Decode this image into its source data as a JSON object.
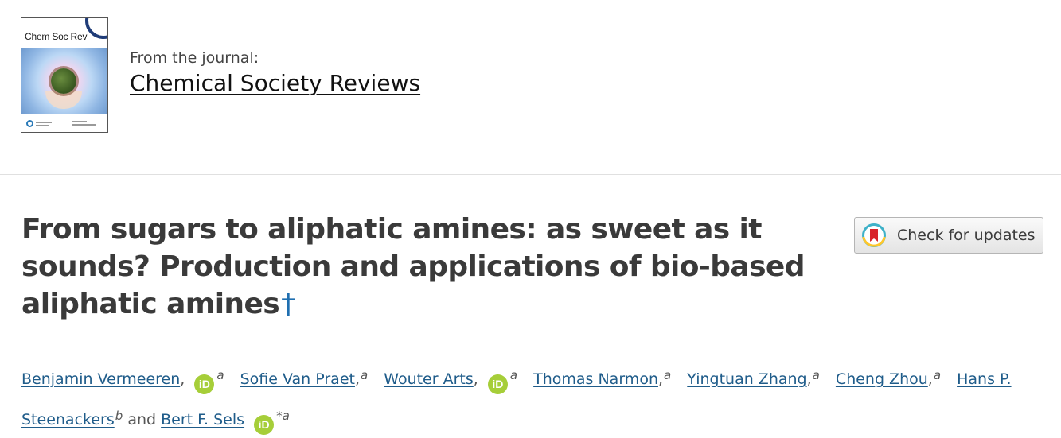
{
  "journal": {
    "cover_title": "Chem Soc Rev",
    "from_label": "From the journal:",
    "name": "Chemical Society Reviews"
  },
  "article": {
    "title": "From sugars to aliphatic amines: as sweet as it sounds? Production and applications of bio-based aliphatic amines",
    "footnote_symbol": "†"
  },
  "updates": {
    "label": "Check for updates",
    "icon": "crossmark-icon"
  },
  "authors": [
    {
      "name": "Benjamin Vermeeren",
      "orcid": true,
      "affiliation": "a"
    },
    {
      "name": "Sofie Van Praet",
      "orcid": false,
      "affiliation": "a"
    },
    {
      "name": "Wouter Arts",
      "orcid": true,
      "affiliation": "a"
    },
    {
      "name": "Thomas Narmon",
      "orcid": false,
      "affiliation": "a"
    },
    {
      "name": "Yingtuan Zhang",
      "orcid": false,
      "affiliation": "a"
    },
    {
      "name": "Cheng Zhou",
      "orcid": false,
      "affiliation": "a"
    },
    {
      "name": "Hans P. Steenackers",
      "orcid": false,
      "affiliation": "b"
    },
    {
      "name": "Bert F. Sels",
      "orcid": true,
      "affiliation": "*a"
    }
  ],
  "authors_conjunction": "and",
  "orcid_glyph": "iD",
  "colors": {
    "link": "#1f5c8a",
    "orcid": "#a6ce39",
    "title": "#3a3a3a",
    "dagger": "#1f6fb0"
  }
}
